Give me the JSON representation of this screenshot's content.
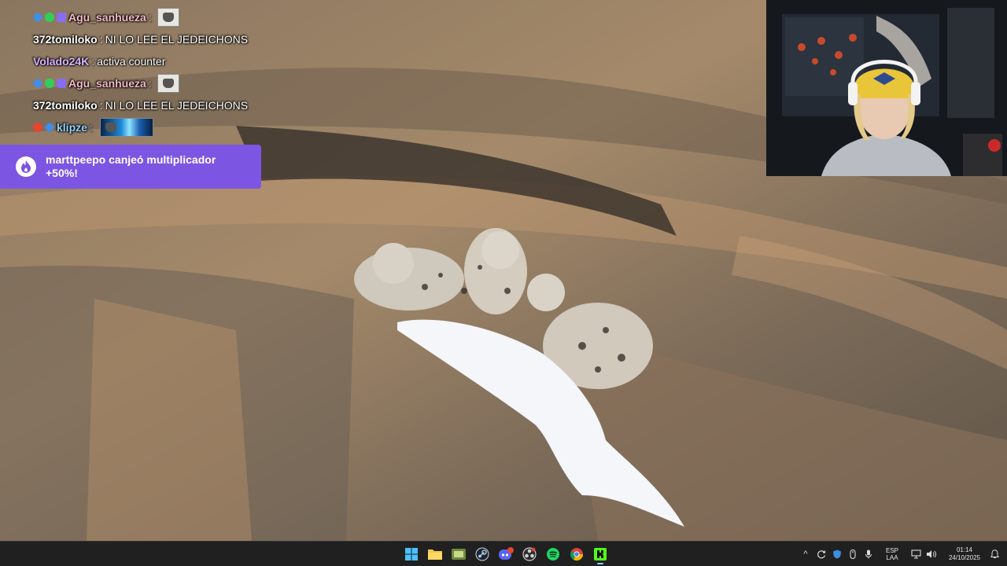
{
  "chat": {
    "lines": [
      {
        "badges": [
          "blue",
          "green",
          "purple"
        ],
        "user": "Agu_sanhueza",
        "user_color": "#f5b9c6",
        "message": "",
        "emote": "sad-face-emote"
      },
      {
        "badges": [],
        "user": "372tomiloko",
        "user_color": "#ffffff",
        "message": "NI LO LEE EL JEDEICHONS"
      },
      {
        "badges": [],
        "user": "Volado24K",
        "user_color": "#d8b4ff",
        "message": "activa counter"
      },
      {
        "badges": [
          "blue",
          "green",
          "purple"
        ],
        "user": "Agu_sanhueza",
        "user_color": "#f5b9c6",
        "message": "",
        "emote": "sad-face-emote"
      },
      {
        "badges": [],
        "user": "372tomiloko",
        "user_color": "#ffffff",
        "message": "NI LO LEE EL JEDEICHONS"
      },
      {
        "badges": [
          "red",
          "blue"
        ],
        "user": "klipze",
        "user_color": "#8fd3ff",
        "message": "",
        "emote": "blue-swirl-emote"
      }
    ]
  },
  "redemption": {
    "text": "marttpeepo canjeó multiplicador +50%!",
    "icon": "flame-icon",
    "color": "#7d55e3"
  },
  "taskbar": {
    "apps": [
      {
        "name": "windows-start-icon"
      },
      {
        "name": "file-explorer-icon"
      },
      {
        "name": "media-app-icon"
      },
      {
        "name": "steam-icon"
      },
      {
        "name": "discord-icon",
        "badge": "9+"
      },
      {
        "name": "obs-icon"
      },
      {
        "name": "spotify-icon"
      },
      {
        "name": "chrome-icon"
      },
      {
        "name": "kick-icon"
      }
    ],
    "tray": {
      "chevron": "^",
      "lang_top": "ESP",
      "lang_bottom": "LAA",
      "time": "01:14",
      "date": "24/10/2025"
    }
  }
}
